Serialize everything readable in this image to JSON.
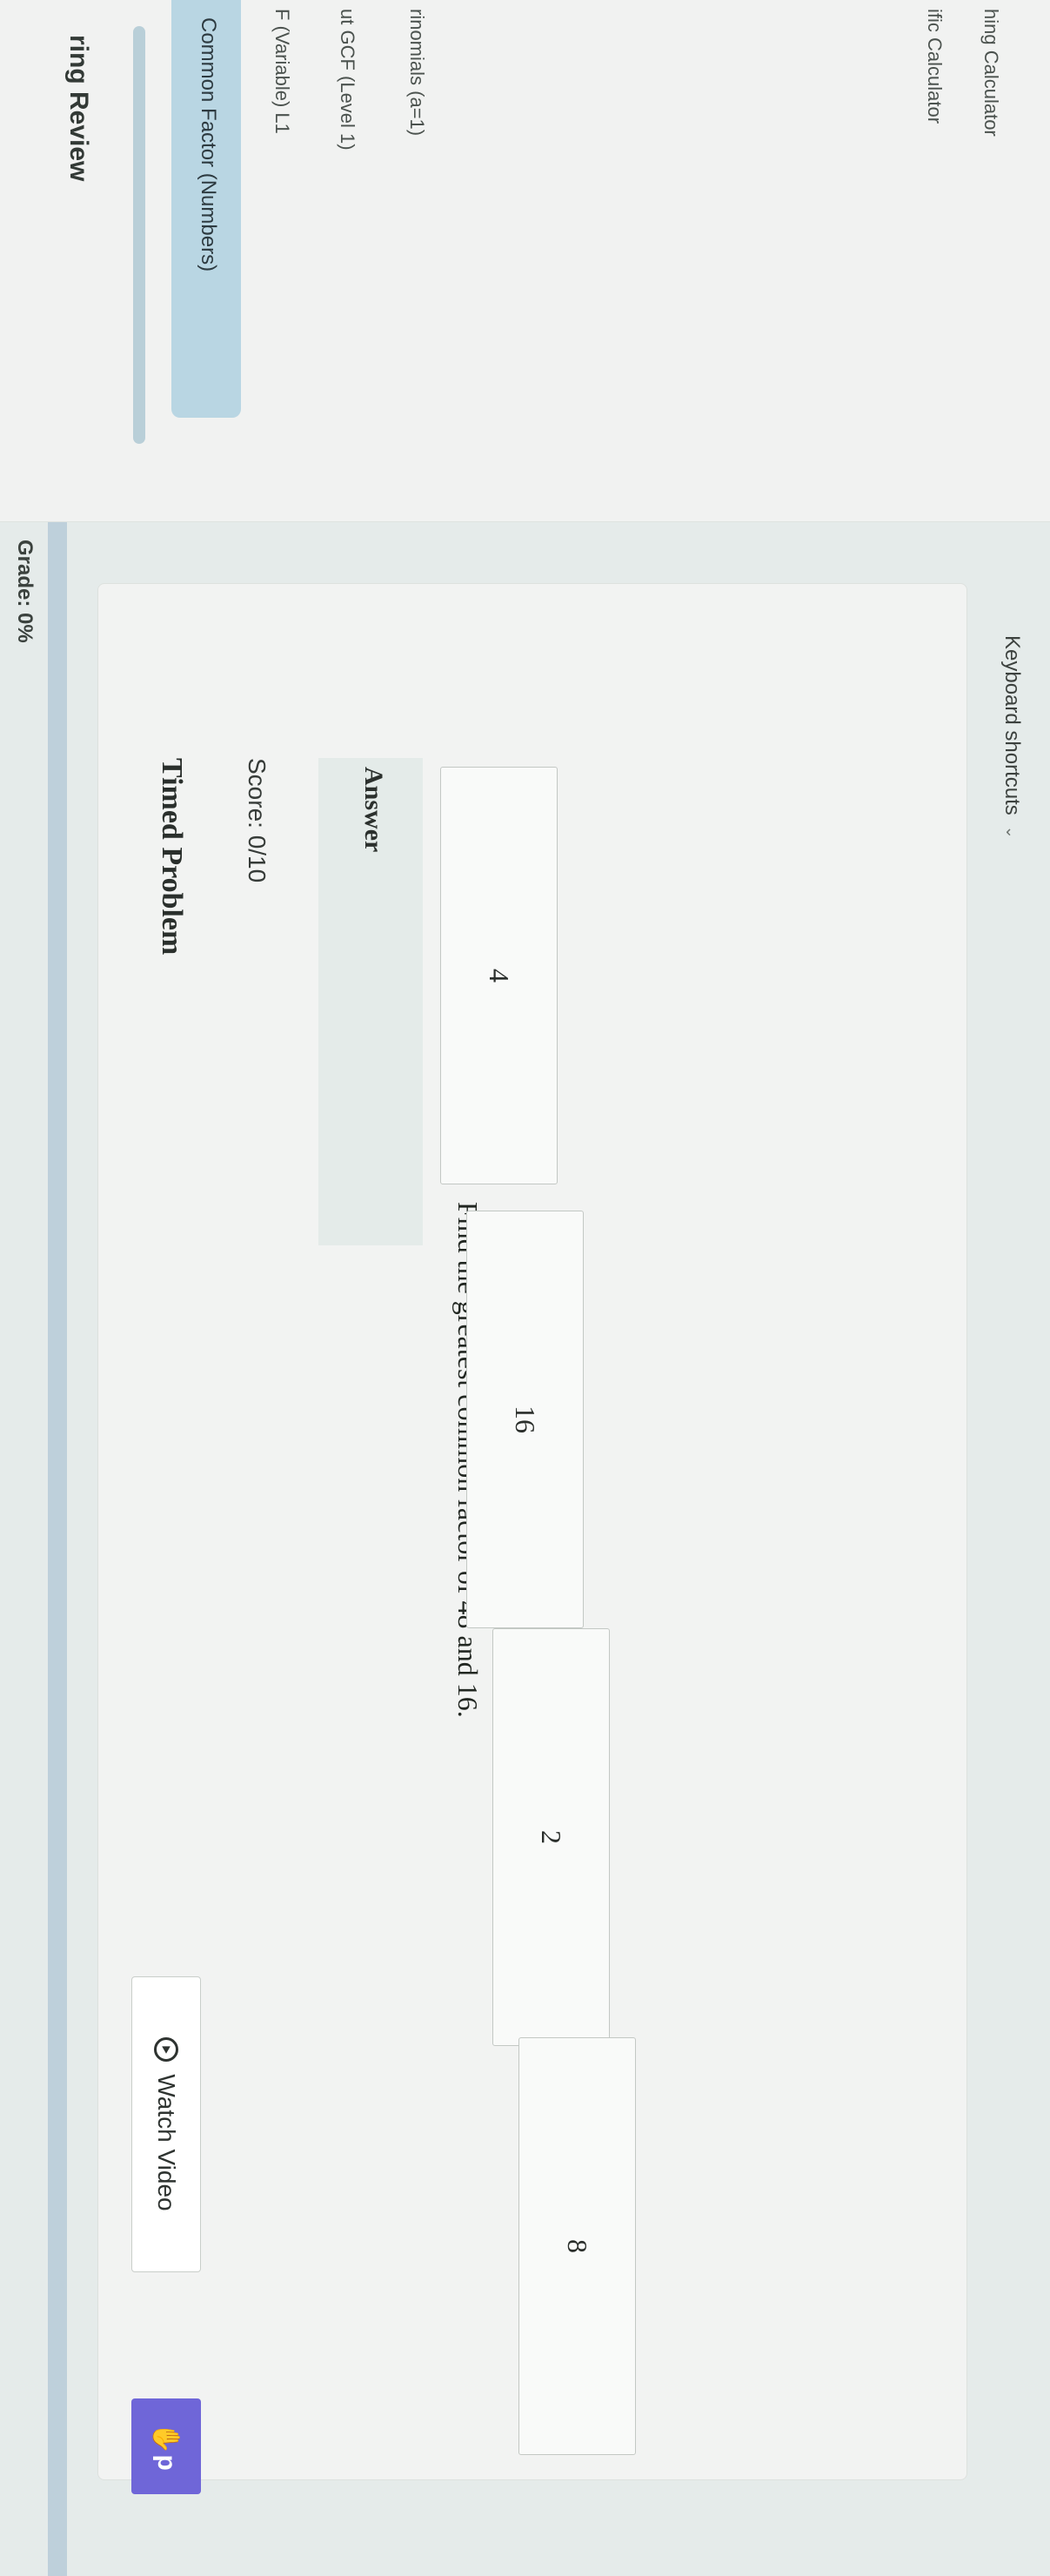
{
  "sidebar": {
    "title": "ring Review",
    "items": [
      {
        "label": "Common Factor (Numbers)",
        "active": true
      },
      {
        "label": "F (Variable) L1",
        "active": false
      },
      {
        "label": "ut GCF (Level 1)",
        "active": false
      },
      {
        "label": "rinomials (a=1)",
        "active": false
      },
      {
        "label": "ific Calculator",
        "active": false
      },
      {
        "label": "hing Calculator",
        "active": false
      }
    ]
  },
  "header": {
    "grade": "Grade: 0%"
  },
  "problem": {
    "title": "Timed Problem",
    "score": "Score: 0/10",
    "watch_video_label": "Watch Video",
    "help_label": "p",
    "question": "Find the greatest common factor of 48 and 16.",
    "answer_label": "Answer",
    "options": [
      "4",
      "16",
      "2",
      "8"
    ]
  },
  "footer": {
    "keyboard_shortcuts": "Keyboard shortcuts"
  },
  "colors": {
    "active_item": "#b9d6e3",
    "help_button": "#6f66d8",
    "progress": "#bed0db"
  }
}
